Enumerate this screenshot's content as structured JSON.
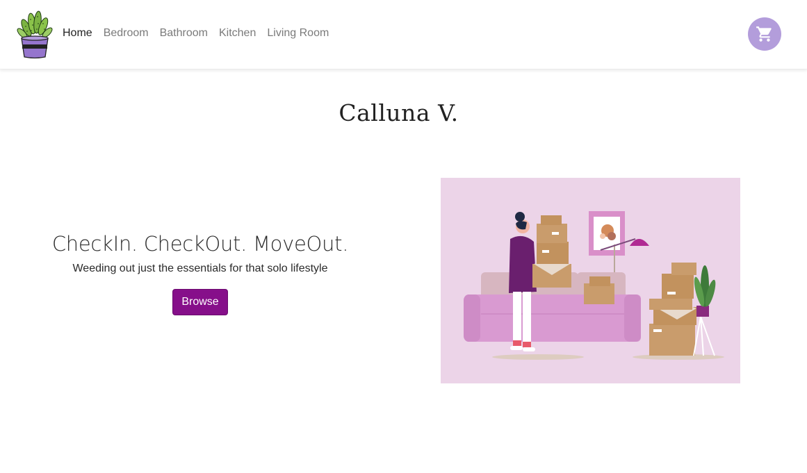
{
  "nav": {
    "items": [
      {
        "label": "Home",
        "active": true
      },
      {
        "label": "Bedroom",
        "active": false
      },
      {
        "label": "Bathroom",
        "active": false
      },
      {
        "label": "Kitchen",
        "active": false
      },
      {
        "label": "Living Room",
        "active": false
      }
    ],
    "logo_icon": "potted-cactus-icon",
    "cart_icon": "shopping-cart-icon"
  },
  "brand": {
    "title": "Calluna V."
  },
  "hero": {
    "tagline": "CheckIn. CheckOut. MoveOut.",
    "subtext": "Weeding out just the essentials for that solo lifestyle",
    "button_label": "Browse",
    "illustration": "woman-moving-boxes-illustration"
  },
  "colors": {
    "accent": "#860f8a",
    "cart_bg": "#b39ddb",
    "illustration_bg": "#ecd4e8"
  }
}
